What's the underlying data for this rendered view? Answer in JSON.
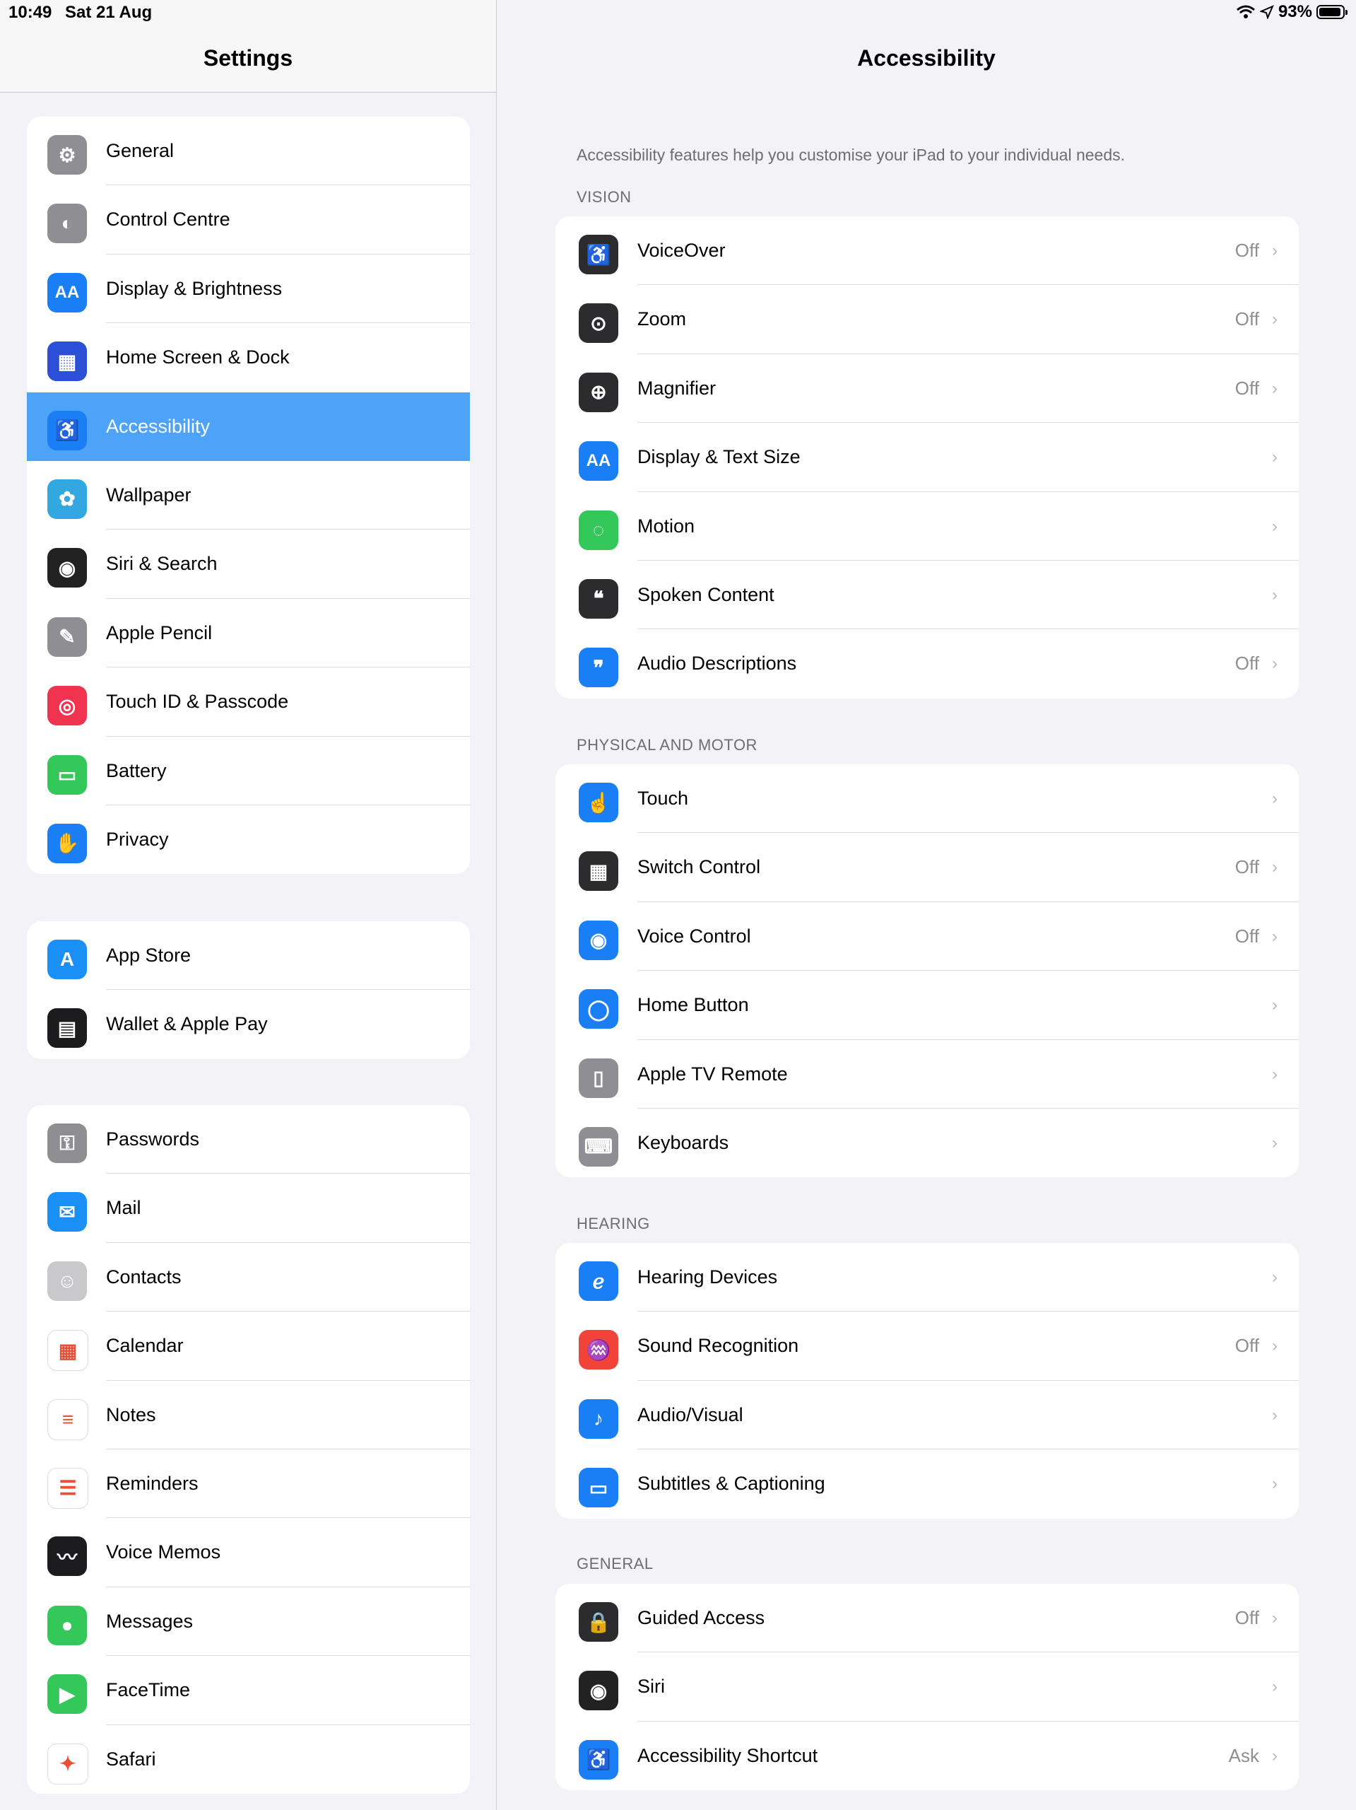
{
  "status_bar": {
    "time": "10:49",
    "date": "Sat 21 Aug",
    "battery": "93%",
    "battery_level": 0.93
  },
  "sidebar": {
    "title": "Settings",
    "groups": [
      {
        "items": [
          {
            "label": "General",
            "icon": "gear-icon",
            "color": "#8e8e93"
          },
          {
            "label": "Control Centre",
            "icon": "toggles-icon",
            "color": "#8e8e93"
          },
          {
            "label": "Display & Brightness",
            "icon": "text-size-icon",
            "color": "#1a7ff5"
          },
          {
            "label": "Home Screen & Dock",
            "icon": "grid-icon",
            "color": "#2b4fd6"
          },
          {
            "label": "Accessibility",
            "icon": "accessibility-icon",
            "color": "#1a7ff5",
            "selected": true
          },
          {
            "label": "Wallpaper",
            "icon": "flower-icon",
            "color": "#33a8e0"
          },
          {
            "label": "Siri & Search",
            "icon": "siri-icon",
            "color": "#222"
          },
          {
            "label": "Apple Pencil",
            "icon": "pencil-icon",
            "color": "#8e8e93"
          },
          {
            "label": "Touch ID & Passcode",
            "icon": "fingerprint-icon",
            "color": "#f0334f"
          },
          {
            "label": "Battery",
            "icon": "battery-icon",
            "color": "#34c759"
          },
          {
            "label": "Privacy",
            "icon": "hand-icon",
            "color": "#1a7ff5"
          }
        ]
      },
      {
        "items": [
          {
            "label": "App Store",
            "icon": "app-store-icon",
            "color": "#1a8ff5"
          },
          {
            "label": "Wallet & Apple Pay",
            "icon": "wallet-icon",
            "color": "#1c1c1e"
          }
        ]
      },
      {
        "items": [
          {
            "label": "Passwords",
            "icon": "key-icon",
            "color": "#8e8e93"
          },
          {
            "label": "Mail",
            "icon": "mail-icon",
            "color": "#1a8ff5"
          },
          {
            "label": "Contacts",
            "icon": "contacts-icon",
            "color": "#c9c9cc"
          },
          {
            "label": "Calendar",
            "icon": "calendar-icon",
            "color": "#ffffff"
          },
          {
            "label": "Notes",
            "icon": "notes-icon",
            "color": "#ffffff"
          },
          {
            "label": "Reminders",
            "icon": "reminders-icon",
            "color": "#ffffff"
          },
          {
            "label": "Voice Memos",
            "icon": "waveform-icon",
            "color": "#1c1c1e"
          },
          {
            "label": "Messages",
            "icon": "message-icon",
            "color": "#34c759"
          },
          {
            "label": "FaceTime",
            "icon": "video-icon",
            "color": "#34c759"
          },
          {
            "label": "Safari",
            "icon": "compass-icon",
            "color": "#ffffff"
          }
        ]
      }
    ]
  },
  "detail": {
    "title": "Accessibility",
    "intro": "Accessibility features help you customise your iPad to your individual needs.",
    "sections": [
      {
        "header": "VISION",
        "items": [
          {
            "label": "VoiceOver",
            "value": "Off",
            "icon": "voiceover-icon",
            "color": "#2c2c2e"
          },
          {
            "label": "Zoom",
            "value": "Off",
            "icon": "zoom-icon",
            "color": "#2c2c2e"
          },
          {
            "label": "Magnifier",
            "value": "Off",
            "icon": "magnifier-icon",
            "color": "#2c2c2e"
          },
          {
            "label": "Display & Text Size",
            "value": "",
            "icon": "text-size-icon",
            "color": "#1a7ff5"
          },
          {
            "label": "Motion",
            "value": "",
            "icon": "motion-icon",
            "color": "#34c759"
          },
          {
            "label": "Spoken Content",
            "value": "",
            "icon": "spoken-content-icon",
            "color": "#2c2c2e"
          },
          {
            "label": "Audio Descriptions",
            "value": "Off",
            "icon": "audio-descriptions-icon",
            "color": "#1a7ff5"
          }
        ]
      },
      {
        "header": "PHYSICAL AND MOTOR",
        "items": [
          {
            "label": "Touch",
            "value": "",
            "icon": "touch-icon",
            "color": "#1a7ff5"
          },
          {
            "label": "Switch Control",
            "value": "Off",
            "icon": "switch-control-icon",
            "color": "#2c2c2e"
          },
          {
            "label": "Voice Control",
            "value": "Off",
            "icon": "voice-control-icon",
            "color": "#1a7ff5"
          },
          {
            "label": "Home Button",
            "value": "",
            "icon": "home-button-icon",
            "color": "#1a7ff5"
          },
          {
            "label": "Apple TV Remote",
            "value": "",
            "icon": "remote-icon",
            "color": "#8e8e93"
          },
          {
            "label": "Keyboards",
            "value": "",
            "icon": "keyboard-icon",
            "color": "#8e8e93"
          }
        ]
      },
      {
        "header": "HEARING",
        "items": [
          {
            "label": "Hearing Devices",
            "value": "",
            "icon": "ear-icon",
            "color": "#1a7ff5"
          },
          {
            "label": "Sound Recognition",
            "value": "Off",
            "icon": "sound-recognition-icon",
            "color": "#f0443a"
          },
          {
            "label": "Audio/Visual",
            "value": "",
            "icon": "audio-visual-icon",
            "color": "#1a7ff5"
          },
          {
            "label": "Subtitles & Captioning",
            "value": "",
            "icon": "captions-icon",
            "color": "#1a7ff5"
          }
        ]
      },
      {
        "header": "GENERAL",
        "items": [
          {
            "label": "Guided Access",
            "value": "Off",
            "icon": "lock-icon",
            "color": "#2c2c2e"
          },
          {
            "label": "Siri",
            "value": "",
            "icon": "siri-icon",
            "color": "#222"
          },
          {
            "label": "Accessibility Shortcut",
            "value": "Ask",
            "icon": "accessibility-icon",
            "color": "#1a7ff5"
          }
        ]
      }
    ]
  }
}
